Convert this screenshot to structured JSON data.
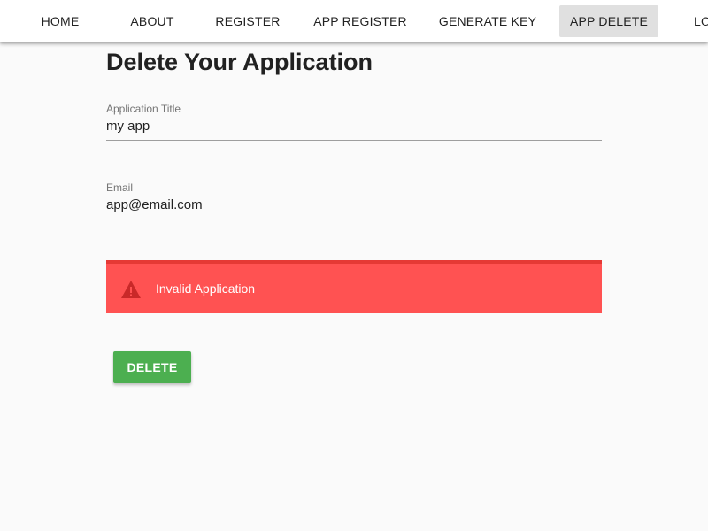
{
  "nav": {
    "items": [
      {
        "label": "HOME"
      },
      {
        "label": "ABOUT"
      },
      {
        "label": "REGISTER"
      },
      {
        "label": "APP REGISTER"
      },
      {
        "label": "GENERATE KEY"
      },
      {
        "label": "APP DELETE",
        "active": true
      },
      {
        "label": "LO"
      }
    ]
  },
  "main": {
    "title": "Delete Your Application",
    "form": {
      "app_title": {
        "label": "Application Title",
        "value": "my app"
      },
      "email": {
        "label": "Email",
        "value": "app@email.com"
      }
    },
    "alert": {
      "icon": "warning-icon",
      "text": "Invalid Application",
      "color": "#ff5252"
    },
    "delete_button": {
      "label": "DELETE",
      "color": "#4caf50"
    }
  }
}
